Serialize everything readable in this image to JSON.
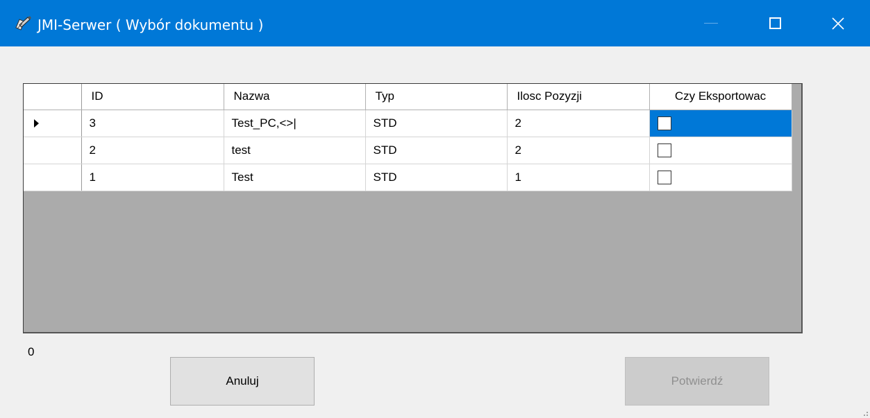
{
  "window": {
    "title": "JMI-Serwer ( Wybór dokumentu )",
    "icon": "pencil-document-icon"
  },
  "grid": {
    "columns": [
      "ID",
      "Nazwa",
      "Typ",
      "Ilosc Pozyzji",
      "Czy Eksportowac"
    ],
    "rows": [
      {
        "id": "3",
        "nazwa": "Test_PC,<>|",
        "typ": "STD",
        "ilosc": "2",
        "eksport": false,
        "current": true
      },
      {
        "id": "2",
        "nazwa": "test",
        "typ": "STD",
        "ilosc": "2",
        "eksport": false,
        "current": false
      },
      {
        "id": "1",
        "nazwa": "Test",
        "typ": "STD",
        "ilosc": "1",
        "eksport": false,
        "current": false
      }
    ]
  },
  "status": {
    "counter": "0"
  },
  "buttons": {
    "cancel": "Anuluj",
    "confirm": "Potwierdź"
  },
  "colors": {
    "titlebar": "#0078d7",
    "selection": "#0078d7",
    "grid_background": "#ababab"
  }
}
